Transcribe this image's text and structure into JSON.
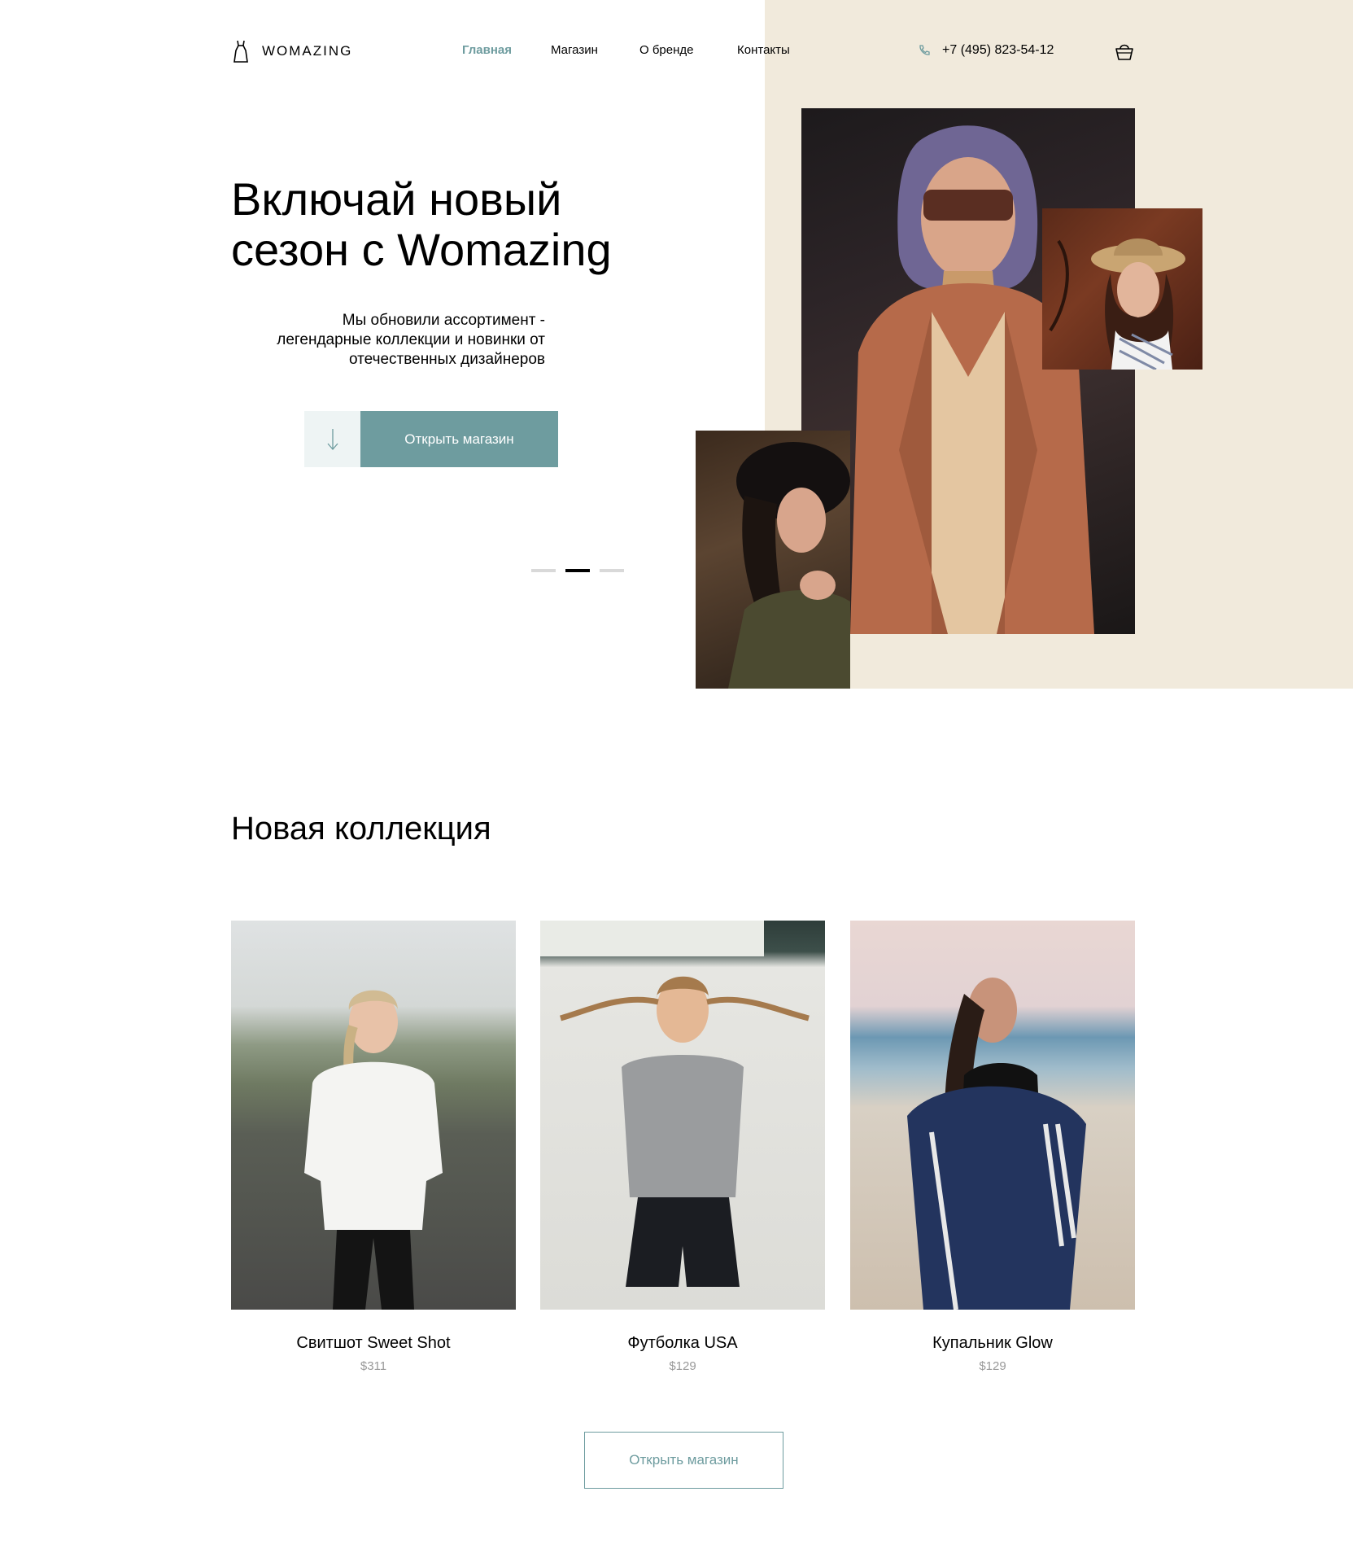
{
  "header": {
    "logo_text": "WOMAZING",
    "nav": [
      {
        "label": "Главная",
        "active": true
      },
      {
        "label": "Магазин",
        "active": false
      },
      {
        "label": "О бренде",
        "active": false
      },
      {
        "label": "Контакты",
        "active": false
      }
    ],
    "phone": "+7 (495) 823-54-12"
  },
  "hero": {
    "title_line1": "Включай новый",
    "title_line2": "сезон с Womazing",
    "subtitle_line1": "Мы обновили ассортимент -",
    "subtitle_line2": "легендарные коллекции и новинки от",
    "subtitle_line3": "отечественных дизайнеров",
    "cta_label": "Открыть магазин",
    "slides_total": 3,
    "slide_active": 2
  },
  "collection": {
    "title": "Новая коллекция",
    "products": [
      {
        "name": "Свитшот Sweet Shot",
        "price": "$311"
      },
      {
        "name": "Футболка USA",
        "price": "$129"
      },
      {
        "name": "Купальник Glow",
        "price": "$129"
      }
    ],
    "cta_label": "Открыть магазин"
  },
  "colors": {
    "accent": "#6e9c9f",
    "beige": "#f1eadc",
    "text": "#000000",
    "price": "#999999"
  },
  "icons": [
    "dress-logo-icon",
    "phone-icon",
    "cart-icon",
    "arrow-down-icon"
  ]
}
